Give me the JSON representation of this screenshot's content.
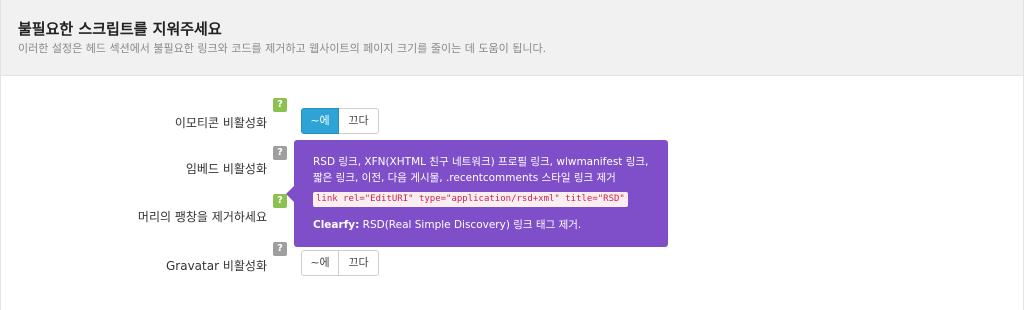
{
  "header": {
    "title": "불필요한 스크립트를 지워주세요",
    "description": "이러한 설정은 헤드 섹션에서 불필요한 링크와 코드를 제거하고 웹사이트의 페이지 크기를 줄이는 데 도움이 됩니다."
  },
  "rows": [
    {
      "label": "이모티콘 비활성화",
      "help": "?",
      "on_label": "~에",
      "off_label": "끄다",
      "active": "on"
    },
    {
      "label": "임베드 비활성화",
      "help": "?"
    },
    {
      "label": "머리의 팽창을 제거하세요",
      "help": "?"
    },
    {
      "label": "Gravatar 비활성화",
      "help": "?",
      "on_label": "~에",
      "off_label": "끄다",
      "active": "none"
    }
  ],
  "tooltip": {
    "line1": "RSD 링크, XFN(XHTML 친구 네트워크) 프로필 링크, wlwmanifest 링크,",
    "line2": "짧은 링크, 이전, 다음 게시물, .recentcomments 스타일 링크 제거",
    "code": "link rel=\"EditURI\" type=\"application/rsd+xml\" title=\"RSD\"",
    "foot_brand": "Clearfy:",
    "foot_text": " RSD(Real Simple Discovery) 링크 태그 제거."
  },
  "colors": {
    "accent": "#2ea3d6",
    "tooltip_bg": "#7e4fc8",
    "help_green": "#8cc152",
    "help_gray": "#9e9e9e"
  }
}
